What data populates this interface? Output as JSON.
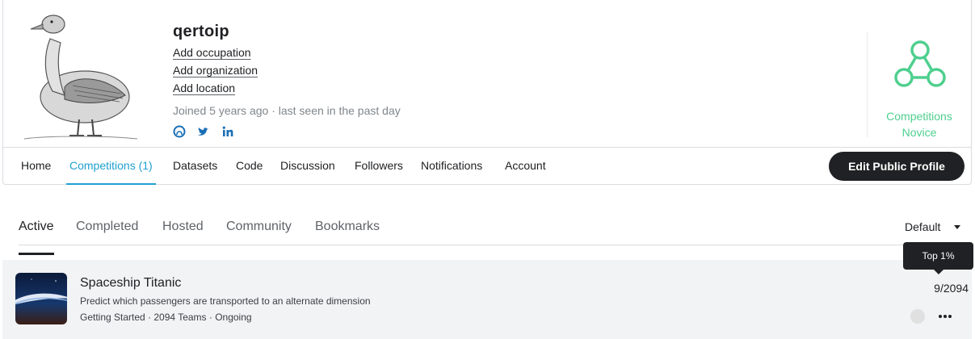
{
  "profile": {
    "username": "qertoip",
    "add_occupation": "Add occupation",
    "add_organization": "Add organization",
    "add_location": "Add location",
    "joined": "Joined 5 years ago · last seen in the past day",
    "tier_line1": "Competitions",
    "tier_line2": "Novice",
    "tier_color": "#4fcf8f",
    "social_icons": [
      "github-icon",
      "twitter-icon",
      "linkedin-icon"
    ]
  },
  "nav": {
    "tabs": [
      "Home",
      "Competitions (1)",
      "Datasets",
      "Code",
      "Discussion",
      "Followers",
      "Notifications",
      "Account"
    ],
    "active": "Competitions (1)",
    "accent": "#20a0d0",
    "edit_label": "Edit Public Profile"
  },
  "subtabs": {
    "items": [
      "Active",
      "Completed",
      "Hosted",
      "Community",
      "Bookmarks"
    ],
    "active": "Active",
    "sort_value": "Default"
  },
  "competition": {
    "title": "Spaceship Titanic",
    "description": "Predict which passengers are transported to an alternate dimension",
    "meta": "Getting Started · 2094 Teams · Ongoing",
    "rank": "9/2094",
    "tooltip": "Top 1%"
  }
}
